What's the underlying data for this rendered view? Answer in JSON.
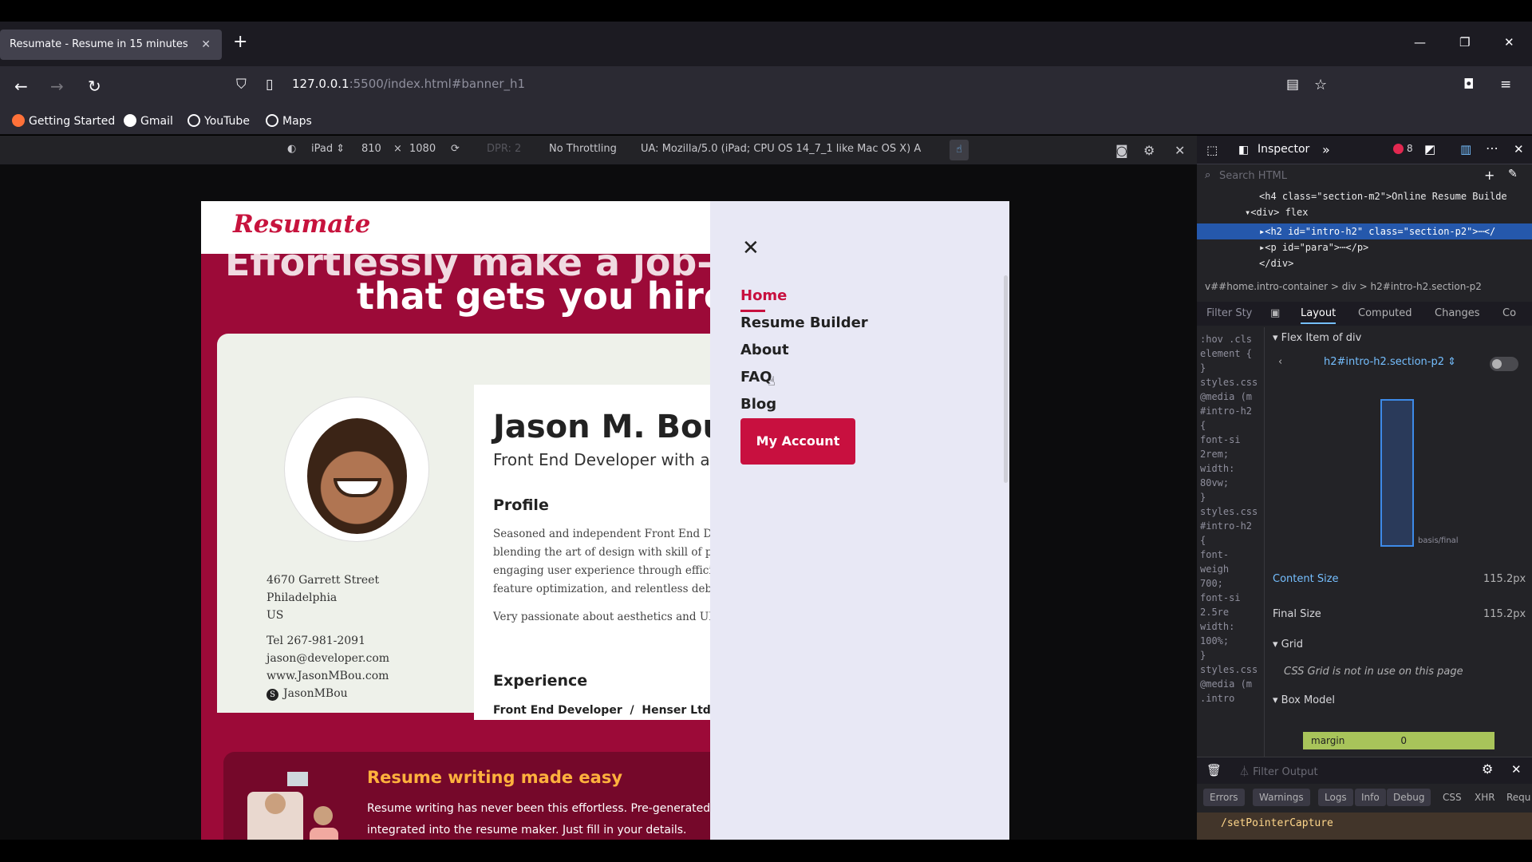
{
  "browser": {
    "tab_title": "Resumate - Resume in 15 minutes",
    "url_host": "127.0.0.1",
    "url_path": ":5500/index.html#banner_h1",
    "bookmarks": [
      "Getting Started",
      "Gmail",
      "YouTube",
      "Maps"
    ]
  },
  "rdm_toolbar": {
    "device": "iPad",
    "width": "810",
    "separator": "×",
    "height": "1080",
    "dpr": "DPR: 2",
    "throttling": "No Throttling",
    "ua": "UA: Mozilla/5.0 (iPad; CPU OS 14_7_1 like Mac OS X) A"
  },
  "page": {
    "logo": "Resumate",
    "hero_line1": "Effortlessly make a job-w",
    "hero_line2": "that gets you hire",
    "resume": {
      "name": "Jason M. Bour",
      "role": "Front End Developer with a",
      "address": [
        "4670 Garrett Street",
        "Philadelphia",
        "US"
      ],
      "contact": [
        "Tel 267-981-2091",
        "jason@developer.com",
        "www.JasonMBou.com",
        "JasonMBou"
      ],
      "profile_heading": "Profile",
      "profile_text": [
        "Seasoned and independent Front End De",
        "blending the art of design with skill of pr",
        "engaging user experience through efficie",
        "feature optimization, and relentless deb"
      ],
      "profile_text2": "Very passionate about aesthetics and UI",
      "experience_heading": "Experience",
      "experience_role": "Front End Developer",
      "experience_sep": "/",
      "experience_company": "Henser Ltd."
    },
    "promo": {
      "title": "Resume writing made easy",
      "body": [
        "Resume writing has never been this effortless. Pre-generated te",
        "integrated into the resume maker. Just fill in your details."
      ]
    }
  },
  "nav": {
    "close": "✕",
    "items": [
      "Home",
      "Resume Builder",
      "About",
      "FAQ",
      "Blog"
    ],
    "account_button": "My Account"
  },
  "devtools": {
    "inspector_tab": "Inspector",
    "error_count": "8",
    "search_placeholder": "Search HTML",
    "tree": [
      "<h4 class=\"section-m2\">Online Resume Builde",
      "▾<div> flex",
      "▸<h2 id=\"intro-h2\" class=\"section-p2\">⋯</",
      "▸<p id=\"para\">⋯</p>",
      "</div>"
    ],
    "breadcrumb": "v##home.intro-container  >  div  >  h2#intro-h2.section-p2",
    "subtabs": [
      "Layout",
      "Computed",
      "Changes",
      "Co"
    ],
    "filter_styles": "Filter Sty",
    "rules": [
      ":hov .cls",
      "element {",
      "}",
      "styles.css",
      "@media (m",
      "#intro-h2",
      "{",
      "font-si",
      "2rem;",
      "width:",
      "80vw;",
      "}",
      "styles.css",
      "#intro-h2",
      "{",
      "font-",
      "weigh",
      "700;",
      "font-si",
      "2.5re",
      "width:",
      "100%;",
      "}",
      "styles.css",
      "@media (m",
      ".intro"
    ],
    "flex_item_label": "Flex Item of div",
    "flex_selector": "h2#intro-h2.section-p2",
    "basis_label": "basis/final",
    "content_size_label": "Content Size",
    "content_size_value": "115.2px",
    "final_size_label": "Final Size",
    "final_size_value": "115.2px",
    "grid_label": "Grid",
    "grid_note": "CSS Grid is not in use on this page",
    "box_model_label": "Box Model",
    "margin_label": "margin",
    "margin_value": "0",
    "filter_output": "Filter Output",
    "console_tabs": [
      "Errors",
      "Warnings",
      "Logs",
      "Info",
      "Debug",
      "CSS",
      "XHR",
      "Requ"
    ],
    "console_msg": "/setPointerCapture"
  }
}
